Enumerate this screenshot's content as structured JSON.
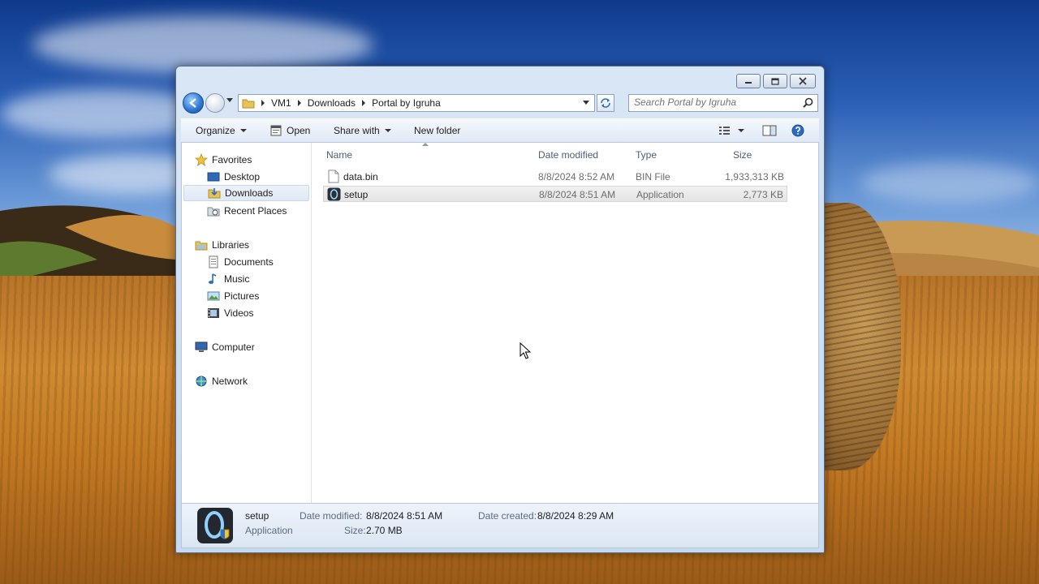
{
  "address": {
    "crumbs": [
      "VM1",
      "Downloads",
      "Portal by Igruha"
    ]
  },
  "search": {
    "placeholder": "Search Portal by Igruha"
  },
  "toolbar": {
    "organize_label": "Organize",
    "open_label": "Open",
    "share_label": "Share with",
    "new_folder_label": "New folder"
  },
  "nav": {
    "favorites": "Favorites",
    "desktop": "Desktop",
    "downloads": "Downloads",
    "recent": "Recent Places",
    "libraries": "Libraries",
    "documents": "Documents",
    "music": "Music",
    "pictures": "Pictures",
    "videos": "Videos",
    "computer": "Computer",
    "network": "Network"
  },
  "columns": {
    "name": "Name",
    "date": "Date modified",
    "type": "Type",
    "size": "Size"
  },
  "files": [
    {
      "name": "data.bin",
      "date": "8/8/2024 8:52 AM",
      "type": "BIN File",
      "size": "1,933,313 KB",
      "icon": "generic-file-icon"
    },
    {
      "name": "setup",
      "date": "8/8/2024 8:51 AM",
      "type": "Application",
      "size": "2,773 KB",
      "icon": "setup-app-icon"
    }
  ],
  "details": {
    "name": "setup",
    "type": "Application",
    "date_modified_label": "Date modified:",
    "date_modified": "8/8/2024 8:51 AM",
    "size_label": "Size:",
    "size": "2.70 MB",
    "date_created_label": "Date created:",
    "date_created": "8/8/2024 8:29 AM"
  },
  "colors": {
    "accent": "#2a74d3",
    "selection": "#e4e4e4",
    "window_chrome": "#c8daf0"
  }
}
